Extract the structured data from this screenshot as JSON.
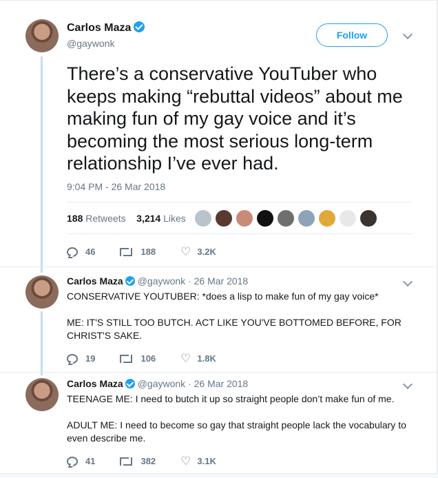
{
  "main_tweet": {
    "author_name": "Carlos Maza",
    "handle": "@gaywonk",
    "follow_label": "Follow",
    "text": "There’s a conservative YouTuber who keeps making “rebuttal videos” about me making fun of my gay voice and it’s becoming the most serious long-term relationship I’ve ever had.",
    "timestamp": "9:04 PM - 26 Mar 2018",
    "retweets_count": "188",
    "retweets_label": "Retweets",
    "likes_count": "3,214",
    "likes_label": "Likes",
    "actions": {
      "replies": "46",
      "retweets": "188",
      "likes": "3.2K"
    }
  },
  "replies": [
    {
      "author_name": "Carlos Maza",
      "meta": "@gaywonk · 26 Mar 2018",
      "text": "CONSERVATIVE YOUTUBER: *does a lisp to make fun of my gay voice*\n\nME: IT'S STILL TOO BUTCH. ACT LIKE YOU'VE BOTTOMED BEFORE, FOR CHRIST'S SAKE.",
      "actions": {
        "replies": "19",
        "retweets": "106",
        "likes": "1.8K"
      }
    },
    {
      "author_name": "Carlos Maza",
      "meta": "@gaywonk · 26 Mar 2018",
      "text": "TEENAGE ME: I need to butch it up so straight people don’t make fun of me.\n\nADULT ME: I need to become so gay that straight people lack the vocabulary to even describe me.",
      "actions": {
        "replies": "41",
        "retweets": "382",
        "likes": "3.1K"
      }
    }
  ],
  "colors": {
    "accent": "#1da1f2",
    "muted": "#657786",
    "text": "#14171a",
    "thread": "#c4dcef"
  },
  "icons": [
    "verified-icon",
    "chevron-down-icon",
    "reply-icon",
    "retweet-icon",
    "heart-icon"
  ]
}
